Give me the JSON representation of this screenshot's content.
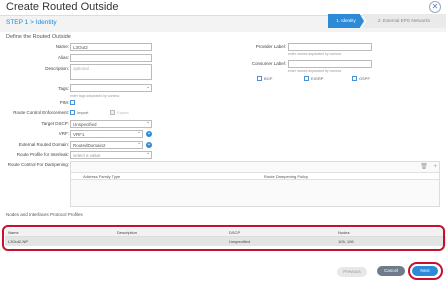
{
  "window": {
    "title": "Create Routed Outside"
  },
  "stepper": {
    "current": "STEP 1 > Identity",
    "tabs": [
      {
        "label": "1. Identity"
      },
      {
        "label": "2. External EPG Networks"
      }
    ]
  },
  "form": {
    "section_title": "Define the Routed Outside",
    "name": {
      "label": "Name:",
      "value": "L3Out2"
    },
    "alias": {
      "label": "Alias:",
      "value": ""
    },
    "description": {
      "label": "Description:",
      "placeholder": "optional"
    },
    "tags": {
      "label": "Tags:",
      "hint": "enter tags separated by comma"
    },
    "pim": {
      "label": "PIM:"
    },
    "rc_enforcement": {
      "label": "Route Control Enforcement:",
      "import": "Import",
      "export": "Export"
    },
    "target_dscp": {
      "label": "Target DSCP:",
      "value": "Unspecified"
    },
    "vrf": {
      "label": "VRF:",
      "value": "VRF1"
    },
    "ext_domain": {
      "label": "External Routed Domain:",
      "value": "RoutedDomain2"
    },
    "route_profile": {
      "label": "Route Profile for Interleak:",
      "placeholder": "select a value"
    },
    "rc_dampening": {
      "label": "Route Control For Dampening:"
    },
    "provider": {
      "label": "Provider Label:",
      "hint": "enter names separated by comma"
    },
    "consumer": {
      "label": "Consumer Label:",
      "hint": "enter names separated by comma"
    },
    "protocols": [
      "BGP",
      "EIGRP",
      "OSPF"
    ]
  },
  "rc_table": {
    "columns": [
      "Address Family Type",
      "Route Dampening Policy"
    ]
  },
  "nodes_section": {
    "title": "Nodes and Interfaces Protocol Profiles",
    "columns": [
      "Name",
      "Description",
      "DSCP",
      "Nodes"
    ],
    "rows": [
      {
        "name": "L3Out2-NP",
        "description": "",
        "dscp": "Unspecified",
        "nodes": "105, 106"
      }
    ]
  },
  "buttons": {
    "previous": "Previous",
    "cancel": "Cancel",
    "next": "Next"
  },
  "colors": {
    "accent": "#2d8ad6",
    "highlight": "#c8102e"
  }
}
